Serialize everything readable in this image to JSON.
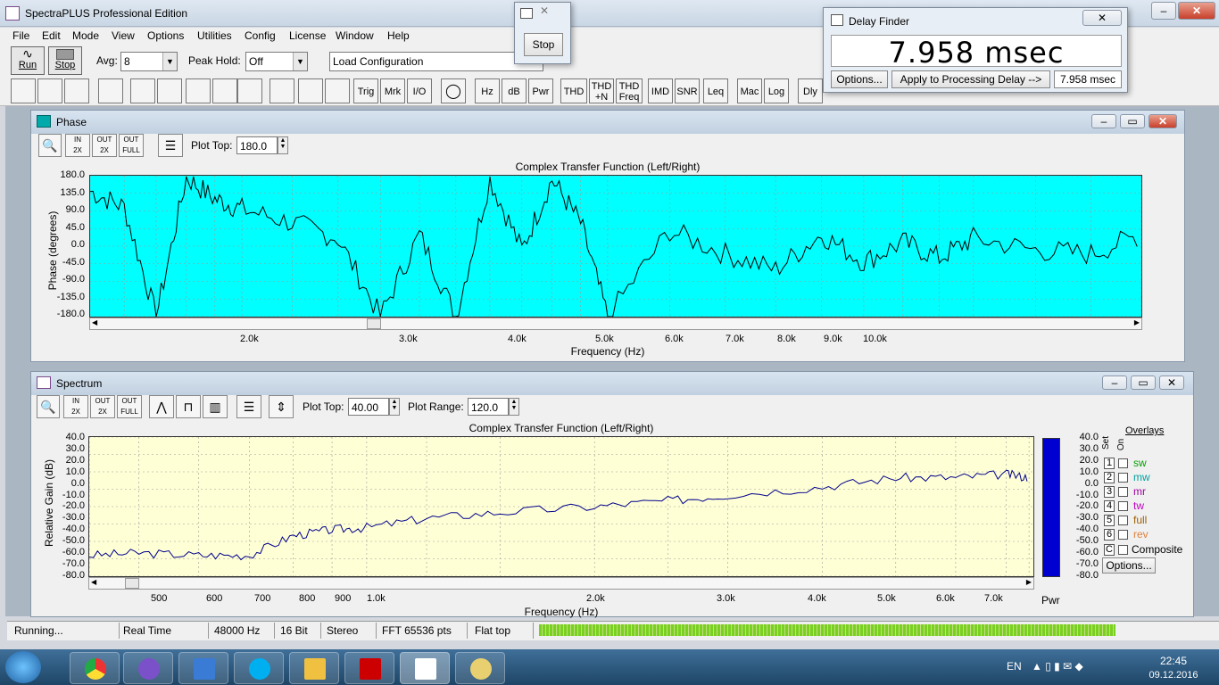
{
  "app": {
    "title": "SpectraPLUS Professional Edition",
    "menu": [
      "File",
      "Edit",
      "Mode",
      "View",
      "Options",
      "Utilities",
      "Config",
      "License",
      "Window",
      "Help"
    ]
  },
  "toolbar1": {
    "run_label": "Run",
    "stop_label": "Stop",
    "avg_label": "Avg:",
    "avg_value": "8",
    "peak_label": "Peak Hold:",
    "peak_value": "Off",
    "config_value": "Load Configuration"
  },
  "toolbar2": {
    "buttons": [
      "Trig",
      "Mrk",
      "I/O",
      "Hz",
      "dB",
      "Pwr",
      "THD",
      "THD +N",
      "THD Freq",
      "IMD",
      "SNR",
      "Leq",
      "Mac",
      "Log",
      "Dly"
    ]
  },
  "stop_popup": {
    "button": "Stop"
  },
  "delay_finder": {
    "title": "Delay Finder",
    "value": "7.958 msec",
    "options_button": "Options...",
    "apply_button": "Apply to Processing Delay -->",
    "result": "7.958 msec"
  },
  "phase_window": {
    "title": "Phase",
    "plot_top_label": "Plot Top:",
    "plot_top_value": "180.0",
    "chart_title": "Complex Transfer Function (Left/Right)",
    "ylabel": "Phase (degrees)",
    "xlabel": "Frequency (Hz)",
    "yticks": [
      "180.0",
      "135.0",
      "90.0",
      "45.0",
      "0.0",
      "-45.0",
      "-90.0",
      "-135.0",
      "-180.0"
    ],
    "xticks": [
      "2.0k",
      "3.0k",
      "4.0k",
      "5.0k",
      "6.0k",
      "7.0k",
      "8.0k",
      "9.0k",
      "10.0k"
    ]
  },
  "spectrum_window": {
    "title": "Spectrum",
    "plot_top_label": "Plot Top:",
    "plot_top_value": "40.00",
    "plot_range_label": "Plot Range:",
    "plot_range_value": "120.0",
    "chart_title": "Complex Transfer Function (Left/Right)",
    "ylabel": "Relative Gain (dB)",
    "xlabel": "Frequency (Hz)",
    "yticks": [
      "40.0",
      "30.0",
      "20.0",
      "10.0",
      "0.0",
      "-10.0",
      "-20.0",
      "-30.0",
      "-40.0",
      "-50.0",
      "-60.0",
      "-70.0",
      "-80.0"
    ],
    "xticks": [
      "500",
      "600",
      "700",
      "800",
      "900",
      "1.0k",
      "2.0k",
      "3.0k",
      "4.0k",
      "5.0k",
      "6.0k",
      "7.0k"
    ],
    "pwr_label": "Pwr",
    "overlays": {
      "title": "Overlays",
      "set_label": "Set",
      "on_label": "On",
      "items": [
        {
          "num": "1",
          "name": "sw",
          "color": "#00a000"
        },
        {
          "num": "2",
          "name": "mw",
          "color": "#00a0a0"
        },
        {
          "num": "3",
          "name": "mr",
          "color": "#a000a0"
        },
        {
          "num": "4",
          "name": "tw",
          "color": "#c000c0"
        },
        {
          "num": "5",
          "name": "full",
          "color": "#a06000"
        },
        {
          "num": "6",
          "name": "rev",
          "color": "#e08040"
        }
      ],
      "composite_num": "C",
      "composite_label": "Composite",
      "options_button": "Options..."
    }
  },
  "chart_data": [
    {
      "type": "line",
      "title": "Complex Transfer Function (Left/Right)",
      "xlabel": "Frequency (Hz)",
      "ylabel": "Phase (degrees)",
      "ylim": [
        -180,
        180
      ],
      "x_scale": "log",
      "x": [
        1500,
        1600,
        1700,
        1800,
        1900,
        2000,
        2200,
        2400,
        2600,
        2800,
        3000,
        3200,
        3400,
        3600,
        3800,
        4000,
        4500,
        5000,
        5500,
        6000,
        6500,
        7000,
        7500,
        8000,
        9000,
        10000,
        11000
      ],
      "series": [
        {
          "values": [
            140,
            100,
            -180,
            175,
            120,
            95,
            60,
            20,
            -180,
            30,
            -180,
            170,
            -10,
            170,
            60,
            -180,
            40,
            -20,
            -60,
            30,
            -40,
            10,
            -30,
            20,
            -10,
            -20,
            30
          ]
        }
      ]
    },
    {
      "type": "line",
      "title": "Complex Transfer Function (Left/Right)",
      "xlabel": "Frequency (Hz)",
      "ylabel": "Relative Gain (dB)",
      "ylim": [
        -80,
        40
      ],
      "x_scale": "log",
      "x": [
        430,
        500,
        600,
        700,
        800,
        900,
        1000,
        1200,
        1500,
        2000,
        2500,
        3000,
        4000,
        5000,
        6000,
        7000,
        7500
      ],
      "series": [
        {
          "values": [
            -62,
            -60,
            -62,
            -62,
            -45,
            -40,
            -38,
            -30,
            -25,
            -20,
            -15,
            -10,
            -3,
            5,
            5,
            8,
            5
          ]
        }
      ]
    }
  ],
  "statusbar": {
    "cells": [
      "Running...",
      "Real Time",
      "48000 Hz",
      "16 Bit",
      "Stereo",
      "FFT 65536 pts",
      "Flat top"
    ]
  },
  "taskbar": {
    "lang": "EN",
    "time": "22:45",
    "date": "09.12.2016"
  }
}
